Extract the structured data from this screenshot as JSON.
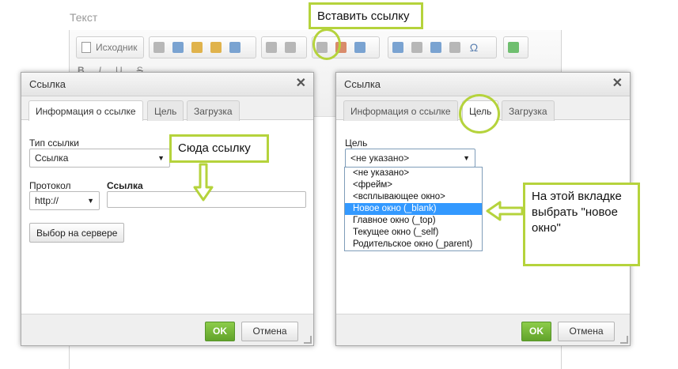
{
  "editor": {
    "label": "Текст",
    "source_button": "Исходник"
  },
  "annotations": {
    "insert_link": "Вставить ссылку",
    "here_link": "Сюда ссылку",
    "choose_new_window": "На этой вкладке выбрать \"новое окно\""
  },
  "left_dialog": {
    "title": "Ссылка",
    "tabs": [
      "Информация о ссылке",
      "Цель",
      "Загрузка"
    ],
    "link_type_label": "Тип ссылки",
    "link_type_value": "Ссылка",
    "protocol_label": "Протокол",
    "protocol_value": "http://",
    "url_label": "Ссылка",
    "url_value": "",
    "browse_server": "Выбор на сервере",
    "ok": "OK",
    "cancel": "Отмена"
  },
  "right_dialog": {
    "title": "Ссылка",
    "tabs": [
      "Информация о ссылке",
      "Цель",
      "Загрузка"
    ],
    "target_label": "Цель",
    "target_value": "<не указано>",
    "target_options": [
      "<не указано>",
      "<фрейм>",
      "<всплывающее окно>",
      "Новое окно (_blank)",
      "Главное окно (_top)",
      "Текущее окно (_self)",
      "Родительское окно (_parent)"
    ],
    "ok": "OK",
    "cancel": "Отмена"
  },
  "colors": {
    "accent": "#b5d33c",
    "ok_button": "#6fb234",
    "selected_option": "#3399ff"
  }
}
